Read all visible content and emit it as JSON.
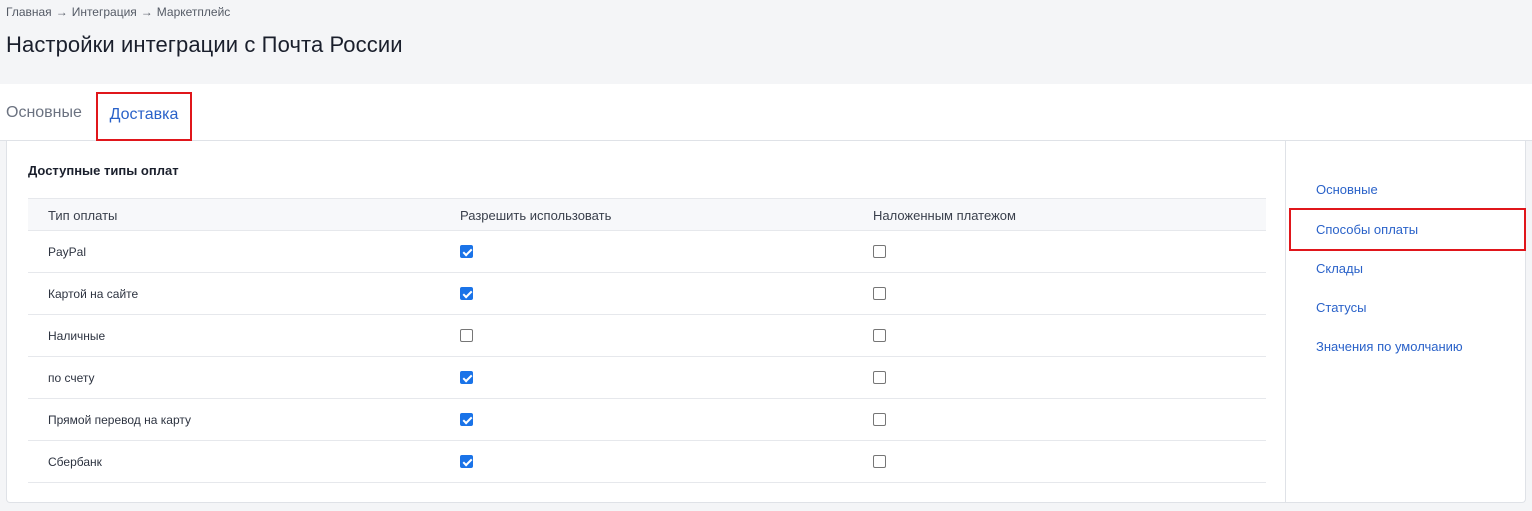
{
  "breadcrumb": {
    "items": [
      "Главная",
      "Интеграция",
      "Маркетплейс"
    ],
    "separator": "→"
  },
  "page_title": "Настройки интеграции с Почта России",
  "tabs": [
    {
      "label": "Основные",
      "active": false
    },
    {
      "label": "Доставка",
      "active": true
    }
  ],
  "section": {
    "title": "Доступные типы оплат",
    "columns": [
      "Тип оплаты",
      "Разрешить использовать",
      "Наложенным платежом"
    ],
    "rows": [
      {
        "name": "PayPal",
        "allow": true,
        "cod": false
      },
      {
        "name": "Картой на сайте",
        "allow": true,
        "cod": false
      },
      {
        "name": "Наличные",
        "allow": false,
        "cod": false
      },
      {
        "name": "по счету",
        "allow": true,
        "cod": false
      },
      {
        "name": "Прямой перевод на карту",
        "allow": true,
        "cod": false
      },
      {
        "name": "Сбербанк",
        "allow": true,
        "cod": false
      }
    ]
  },
  "side_nav": {
    "items": [
      {
        "label": "Основные",
        "highlighted": false
      },
      {
        "label": "Способы оплаты",
        "highlighted": true
      },
      {
        "label": "Склады",
        "highlighted": false
      },
      {
        "label": "Статусы",
        "highlighted": false
      },
      {
        "label": "Значения по умолчанию",
        "highlighted": false
      }
    ]
  },
  "colors": {
    "accent": "#2a62c9",
    "checkbox_checked": "#1a73e8",
    "highlight_frame": "#e0161b"
  }
}
